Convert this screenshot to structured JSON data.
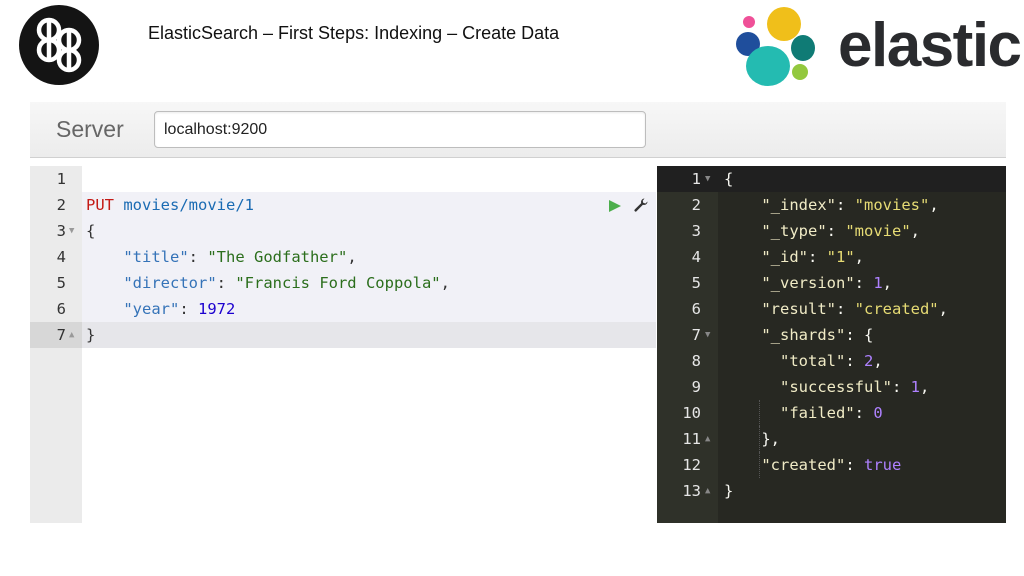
{
  "slide": {
    "title": "ElasticSearch – First Steps: Indexing – Create Data",
    "brand": "elastic",
    "logo_left_icon": "db-logo-icon",
    "logo_right_icon": "elastic-logo-icon"
  },
  "server": {
    "label": "Server",
    "value": "localhost:9200"
  },
  "request": {
    "method": "PUT",
    "path": "movies/movie/1",
    "line_numbers": [
      "1",
      "2",
      "3",
      "4",
      "5",
      "6",
      "7"
    ],
    "keys": {
      "title": "\"title\"",
      "director": "\"director\"",
      "year": "\"year\""
    },
    "values": {
      "title": "\"The Godfather\"",
      "director": "\"Francis Ford Coppola\"",
      "year": "1972"
    },
    "open_brace": "{",
    "close_brace": "}",
    "run_icon": "play-icon",
    "settings_icon": "wrench-icon"
  },
  "response": {
    "line_numbers": [
      "1",
      "2",
      "3",
      "4",
      "5",
      "6",
      "7",
      "8",
      "9",
      "10",
      "11",
      "12",
      "13"
    ],
    "keys": {
      "index": "\"_index\"",
      "type": "\"_type\"",
      "id": "\"_id\"",
      "version": "\"_version\"",
      "result": "\"result\"",
      "shards": "\"_shards\"",
      "total": "\"total\"",
      "successful": "\"successful\"",
      "failed": "\"failed\"",
      "created": "\"created\""
    },
    "values": {
      "index": "\"movies\"",
      "type": "\"movie\"",
      "id": "\"1\"",
      "version": "1",
      "result": "\"created\"",
      "total": "2",
      "successful": "1",
      "failed": "0",
      "created": "true"
    }
  },
  "colors": {
    "editor_dark_bg": "#272822",
    "method_red": "#c41a16",
    "run_green": "#4cae4c"
  }
}
